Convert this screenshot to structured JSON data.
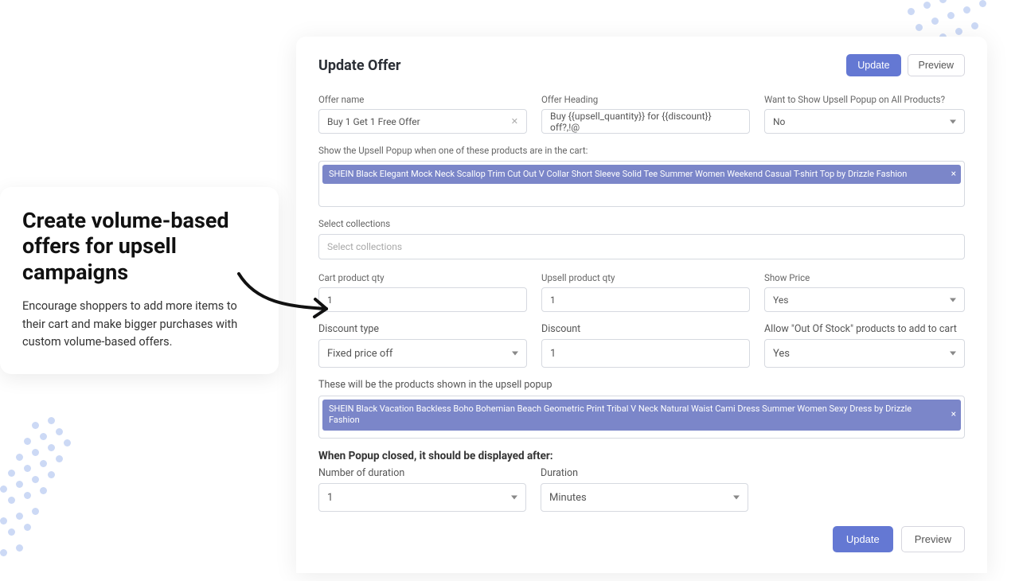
{
  "callout": {
    "title": "Create volume-based offers for upsell campaigns",
    "body": "Encourage shoppers to add more items to their cart and make bigger purchases with custom volume-based offers."
  },
  "header": {
    "title": "Update Offer",
    "update": "Update",
    "preview": "Preview"
  },
  "fields": {
    "offer_name_label": "Offer name",
    "offer_name_value": "Buy 1 Get 1 Free Offer",
    "offer_heading_label": "Offer Heading",
    "offer_heading_value": "Buy {{upsell_quantity}} for {{discount}} off?,!@",
    "show_all_label": "Want to Show Upsell Popup on All Products?",
    "show_all_value": "No",
    "trigger_hint": "Show the Upsell Popup when one of these products are in the cart:",
    "trigger_tag": "SHEIN Black Elegant Mock Neck Scallop Trim Cut Out V Collar Short Sleeve Solid Tee Summer Women Weekend Casual T-shirt Top by Drizzle Fashion",
    "select_collections_label": "Select collections",
    "select_collections_placeholder": "Select collections",
    "cart_qty_label": "Cart product qty",
    "cart_qty_value": "1",
    "upsell_qty_label": "Upsell product qty",
    "upsell_qty_value": "1",
    "show_price_label": "Show Price",
    "show_price_value": "Yes",
    "discount_type_label": "Discount type",
    "discount_type_value": "Fixed price off",
    "discount_label": "Discount",
    "discount_value": "1",
    "oos_label": "Allow \"Out Of Stock\" products to add to cart",
    "oos_value": "Yes",
    "popup_products_hint": "These will be the products shown in the upsell popup",
    "popup_tag": "SHEIN Black Vacation Backless Boho Bohemian Beach Geometric Print Tribal V Neck Natural Waist Cami Dress Summer Women Sexy Dress by Drizzle Fashion",
    "redisplay_heading": "When Popup closed, it should be displayed after:",
    "num_duration_label": "Number of duration",
    "num_duration_value": "1",
    "duration_label": "Duration",
    "duration_value": "Minutes"
  },
  "footer": {
    "update": "Update",
    "preview": "Preview"
  }
}
